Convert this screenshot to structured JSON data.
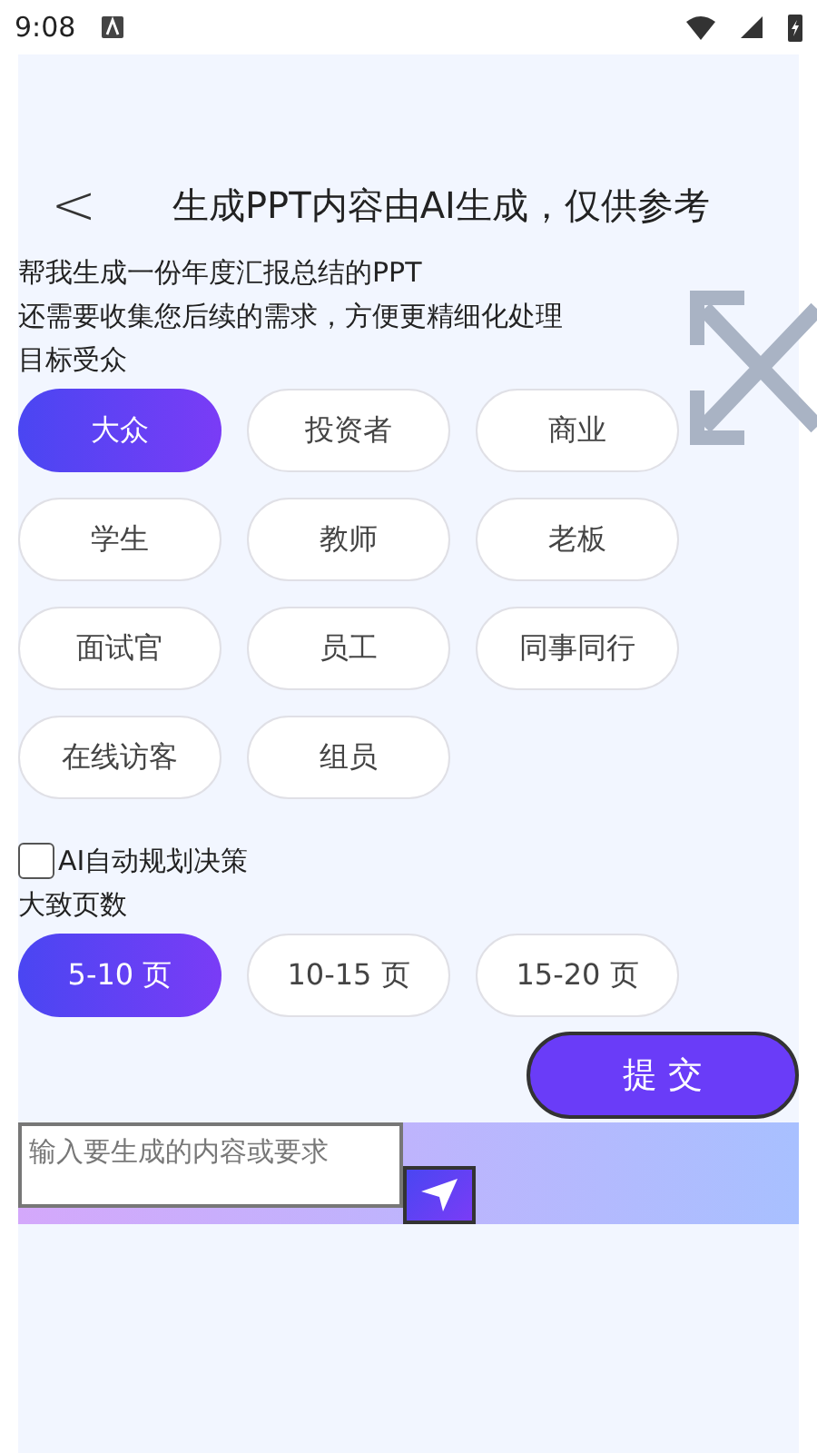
{
  "status_bar": {
    "time": "9:08"
  },
  "header": {
    "back": "<",
    "title": "生成PPT内容由AI生成，仅供参考"
  },
  "intro": [
    "帮我生成一份年度汇报总结的PPT",
    "还需要收集您后续的需求，方便更精细化处理"
  ],
  "audience": {
    "label": "目标受众",
    "options": [
      {
        "label": "大众",
        "selected": true
      },
      {
        "label": "投资者",
        "selected": false
      },
      {
        "label": "商业",
        "selected": false
      },
      {
        "label": "学生",
        "selected": false
      },
      {
        "label": "教师",
        "selected": false
      },
      {
        "label": "老板",
        "selected": false
      },
      {
        "label": "面试官",
        "selected": false
      },
      {
        "label": "员工",
        "selected": false
      },
      {
        "label": "同事同行",
        "selected": false
      },
      {
        "label": "在线访客",
        "selected": false
      },
      {
        "label": "组员",
        "selected": false
      }
    ]
  },
  "auto_plan": {
    "label": "AI自动规划决策",
    "checked": false
  },
  "pages": {
    "label": "大致页数",
    "options": [
      {
        "label": "5-10 页",
        "selected": true
      },
      {
        "label": "10-15 页",
        "selected": false
      },
      {
        "label": "15-20 页",
        "selected": false
      }
    ]
  },
  "submit": "提 交",
  "composer": {
    "placeholder": "输入要生成的内容或要求"
  }
}
